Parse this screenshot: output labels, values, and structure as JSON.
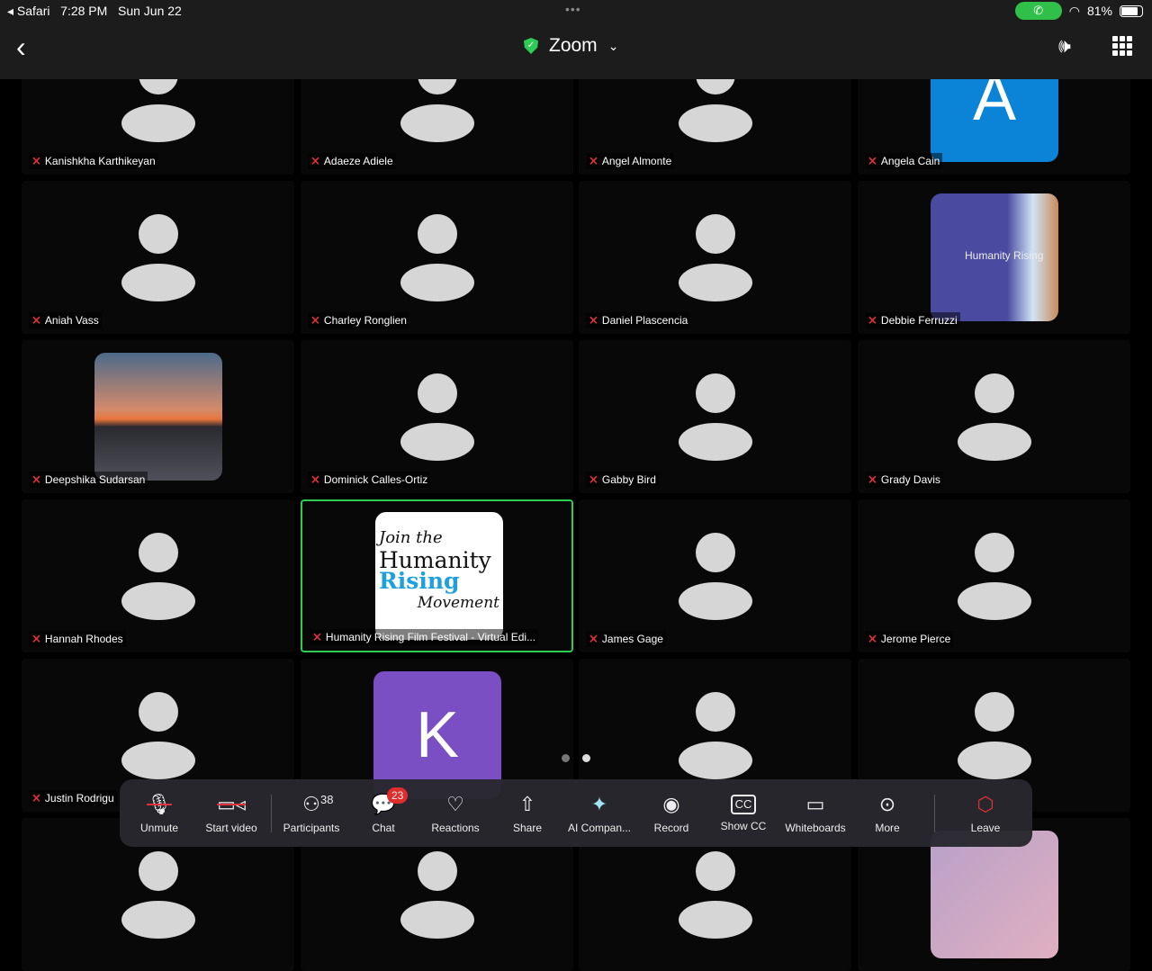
{
  "status": {
    "app": "Safari",
    "time": "7:28 PM",
    "date": "Sun Jun 22",
    "battery": "81%",
    "battery_level": 0.81
  },
  "header": {
    "title": "Zoom"
  },
  "tiles": [
    {
      "name": "Kanishkha Karthikeyan",
      "type": "avatar"
    },
    {
      "name": "Adaeze Adiele",
      "type": "avatar"
    },
    {
      "name": "Angel Almonte",
      "type": "avatar"
    },
    {
      "name": "Angela Cain",
      "type": "letter",
      "letter": "A",
      "color": "#0b84d8"
    },
    {
      "name": "Aniah Vass",
      "type": "avatar"
    },
    {
      "name": "Charley Ronglien",
      "type": "avatar"
    },
    {
      "name": "Daniel Plascencia",
      "type": "avatar"
    },
    {
      "name": "Debbie Ferruzzi",
      "type": "humanity",
      "logo_text": "Humanity Rising"
    },
    {
      "name": "Deepshika Sudarsan",
      "type": "sunset"
    },
    {
      "name": "Dominick Calles-Ortiz",
      "type": "avatar"
    },
    {
      "name": "Gabby Bird",
      "type": "avatar"
    },
    {
      "name": "Grady Davis",
      "type": "avatar"
    },
    {
      "name": "Hannah Rhodes",
      "type": "avatar"
    },
    {
      "name": "Humanity Rising Film Festival - Virtual Edi...",
      "type": "card",
      "active": true,
      "card": [
        "Join the",
        "Humanity",
        "Rising",
        "Movement"
      ]
    },
    {
      "name": "James Gage",
      "type": "avatar"
    },
    {
      "name": "Jerome Pierce",
      "type": "avatar"
    },
    {
      "name": "Justin Rodrigu",
      "type": "avatar"
    },
    {
      "name": "",
      "type": "letter",
      "letter": "K",
      "color": "#7b4fc4"
    },
    {
      "name": "",
      "type": "avatar"
    },
    {
      "name": "",
      "type": "avatar"
    },
    {
      "name": "",
      "type": "avatar"
    },
    {
      "name": "",
      "type": "avatar"
    },
    {
      "name": "",
      "type": "avatar"
    },
    {
      "name": "",
      "type": "pink"
    }
  ],
  "pager": {
    "pages": 2,
    "current": 2
  },
  "toolbar": {
    "unmute": "Unmute",
    "start_video": "Start video",
    "participants": "Participants",
    "participants_count": "38",
    "chat": "Chat",
    "chat_badge": "23",
    "reactions": "Reactions",
    "share": "Share",
    "ai": "AI Compan...",
    "record": "Record",
    "cc": "Show CC",
    "whiteboards": "Whiteboards",
    "more": "More",
    "leave": "Leave"
  }
}
